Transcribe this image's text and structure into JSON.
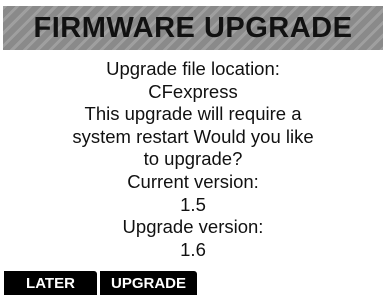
{
  "dialog": {
    "title": "FIRMWARE UPGRADE",
    "lines": [
      "Upgrade file location:",
      "CFexpress",
      "This upgrade will require a",
      "system restart Would you like",
      "to upgrade?",
      "Current version:",
      "1.5",
      "Upgrade version:",
      "1.6"
    ]
  },
  "buttons": {
    "later_label": "LATER",
    "upgrade_label": "UPGRADE"
  },
  "colors": {
    "title_bar": "#8a8a8a",
    "button_bg": "#000000",
    "button_text": "#ffffff",
    "text": "#111111",
    "background": "#ffffff"
  }
}
